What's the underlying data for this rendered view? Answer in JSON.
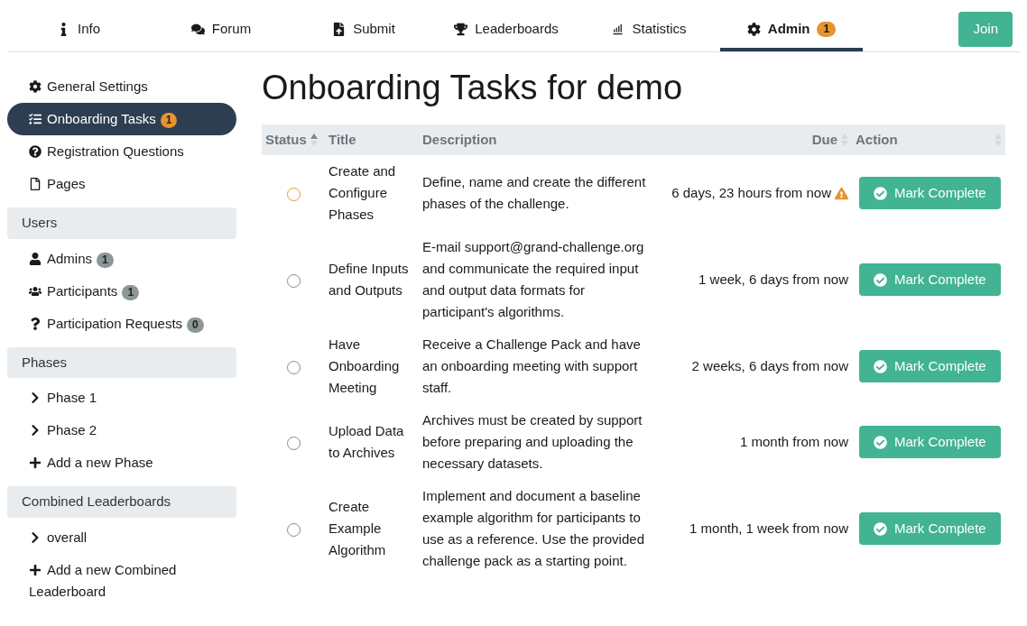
{
  "tabs": [
    {
      "label": "Info",
      "selected": false
    },
    {
      "label": "Forum",
      "selected": false
    },
    {
      "label": "Submit",
      "selected": false
    },
    {
      "label": "Leaderboards",
      "selected": false
    },
    {
      "label": "Statistics",
      "selected": false
    },
    {
      "label": "Admin",
      "selected": true,
      "badge": "1"
    }
  ],
  "join_button": "Join",
  "sidebar": [
    {
      "items": [
        {
          "label": "General Settings",
          "selected": false
        },
        {
          "label": "Onboarding Tasks",
          "selected": true,
          "badge": "1",
          "color": "#e69430"
        },
        {
          "label": "Registration Questions",
          "selected": false
        },
        {
          "label": "Pages",
          "selected": false
        }
      ]
    },
    {
      "heading": "Users",
      "items": [
        {
          "label": "Admins",
          "selected": false,
          "badge": "1",
          "color": "#8c9797"
        },
        {
          "label": "Participants",
          "selected": false,
          "badge": "1",
          "color": "#8c9797"
        },
        {
          "label": "Participation Requests",
          "selected": false,
          "badge": "0",
          "color": "#8c9797"
        }
      ]
    },
    {
      "heading": "Phases",
      "items": [
        {
          "label": "Phase 1",
          "selected": false
        },
        {
          "label": "Phase 2",
          "selected": false
        },
        {
          "label": "Add a new Phase",
          "selected": false
        }
      ]
    },
    {
      "heading": "Combined Leaderboards",
      "items": [
        {
          "label": "overall",
          "selected": false
        },
        {
          "label": "Add a new Combined Leaderboard",
          "selected": false
        }
      ]
    }
  ],
  "page_title": "Onboarding Tasks for demo",
  "table": {
    "columns": [
      {
        "label": "Status",
        "sortable": true,
        "sorted": true
      },
      {
        "label": "Title",
        "sortable": false
      },
      {
        "label": "Description",
        "sortable": false
      },
      {
        "label": "Due",
        "sortable": true,
        "sorted": false
      },
      {
        "label": "Action",
        "sortable": true,
        "sorted": false
      }
    ],
    "rows": [
      {
        "title": "Create and Configure Phases",
        "description": "Define, name and create the different phases of the challenge.",
        "due": "6 days, 23 hours from now",
        "warning": true,
        "action": "Mark Complete"
      },
      {
        "title": "Define Inputs and Outputs",
        "description": "E-mail support@grand-challenge.org and communicate the required input and output data formats for participant's algorithms.",
        "due": "1 week, 6 days from now",
        "warning": false,
        "action": "Mark Complete"
      },
      {
        "title": "Have Onboarding Meeting",
        "description": "Receive a Challenge Pack and have an onboarding meeting with support staff.",
        "due": "2 weeks, 6 days from now",
        "warning": false,
        "action": "Mark Complete"
      },
      {
        "title": "Upload Data to Archives",
        "description": "Archives must be created by support before preparing and uploading the necessary datasets.",
        "due": "1 month from now",
        "warning": false,
        "action": "Mark Complete"
      },
      {
        "title": "Create Example Algorithm",
        "description": "Implement and document a baseline example algorithm for participants to use as a reference. Use the provided challenge pack as a starting point.",
        "due": "1 month, 1 week from now",
        "warning": false,
        "action": "Mark Complete"
      }
    ]
  }
}
